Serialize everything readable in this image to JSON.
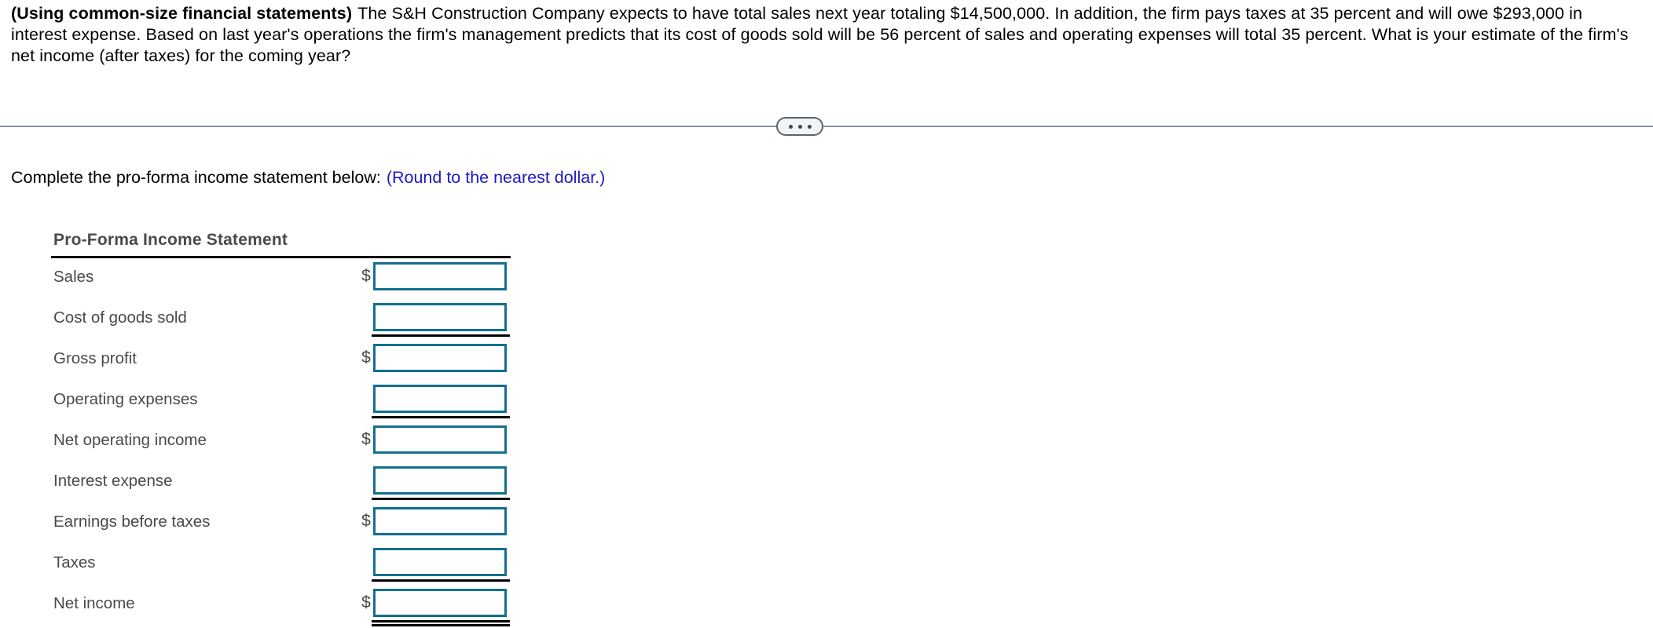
{
  "question": {
    "label": "(Using common-size financial statements)",
    "body": "The S&H Construction Company expects to have total sales next year totaling $14,500,000.  In addition, the firm pays taxes at 35 percent and will owe $293,000 in interest expense.  Based on last year's operations the firm's management predicts that its cost of goods sold will be 56 percent of sales and operating expenses will total 35 percent.  What is your estimate of the firm's net income (after taxes) for the coming year?"
  },
  "divider": {
    "ellipsis_label": "...",
    "line_color": "#868e9c"
  },
  "instruction": {
    "text": "Complete the pro-forma income statement below:",
    "round_note": "(Round to the nearest dollar.)",
    "round_note_color": "#1d19c4"
  },
  "statement": {
    "title": "Pro-Forma Income Statement",
    "accent_color": "#127090",
    "label_color": "#4a4a4a",
    "rows": [
      {
        "label": "Sales",
        "dollar": "$",
        "value": "",
        "placeholder": "",
        "rule": "none"
      },
      {
        "label": "Cost of goods sold",
        "dollar": "",
        "value": "",
        "placeholder": "",
        "rule": "single"
      },
      {
        "label": "Gross profit",
        "dollar": "$",
        "value": "",
        "placeholder": "",
        "rule": "none"
      },
      {
        "label": "Operating expenses",
        "dollar": "",
        "value": "",
        "placeholder": "",
        "rule": "single"
      },
      {
        "label": "Net operating income",
        "dollar": "$",
        "value": "",
        "placeholder": "",
        "rule": "none"
      },
      {
        "label": "Interest expense",
        "dollar": "",
        "value": "",
        "placeholder": "",
        "rule": "single"
      },
      {
        "label": "Earnings before taxes",
        "dollar": "$",
        "value": "",
        "placeholder": "",
        "rule": "none"
      },
      {
        "label": "Taxes",
        "dollar": "",
        "value": "",
        "placeholder": "",
        "rule": "single"
      },
      {
        "label": "Net income",
        "dollar": "$",
        "value": "",
        "placeholder": "",
        "rule": "double"
      }
    ]
  }
}
